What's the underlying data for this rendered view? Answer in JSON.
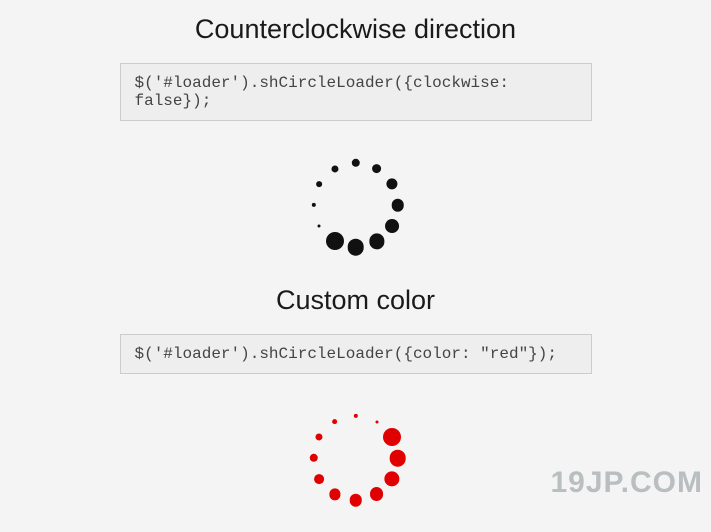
{
  "section1": {
    "title": "Counterclockwise direction",
    "code": "$('#loader').shCircleLoader({clockwise: false});",
    "loader": {
      "color": "#111111",
      "direction": "ccw",
      "dotCount": 12,
      "radius": 42,
      "minDot": 3,
      "maxDot": 18,
      "startAngle": 270,
      "largestAtIndex": 5
    }
  },
  "section2": {
    "title": "Custom color",
    "code": "$('#loader').shCircleLoader({color: \"red\"});",
    "loader": {
      "color": "#e00000",
      "direction": "cw",
      "dotCount": 12,
      "radius": 42,
      "minDot": 3,
      "maxDot": 18,
      "startAngle": 270,
      "largestAtIndex": 2
    }
  },
  "watermark": "19JP.COM"
}
